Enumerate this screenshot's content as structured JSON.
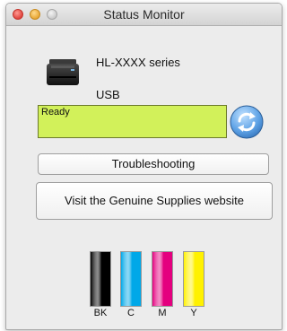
{
  "window": {
    "title": "Status Monitor"
  },
  "device": {
    "model": "HL-XXXX series",
    "connection": "USB",
    "icon": "printer-icon"
  },
  "status": {
    "text": "Ready",
    "color": "#d2f15a"
  },
  "buttons": {
    "troubleshooting": "Troubleshooting",
    "supplies": "Visit the Genuine Supplies website",
    "refresh_icon": "refresh-icon"
  },
  "ink_levels": [
    {
      "label": "BK",
      "color": "#000000",
      "level": 1.0
    },
    {
      "label": "C",
      "color": "#00a8e8",
      "level": 1.0
    },
    {
      "label": "M",
      "color": "#e4007f",
      "level": 1.0
    },
    {
      "label": "Y",
      "color": "#fff100",
      "level": 1.0
    }
  ]
}
